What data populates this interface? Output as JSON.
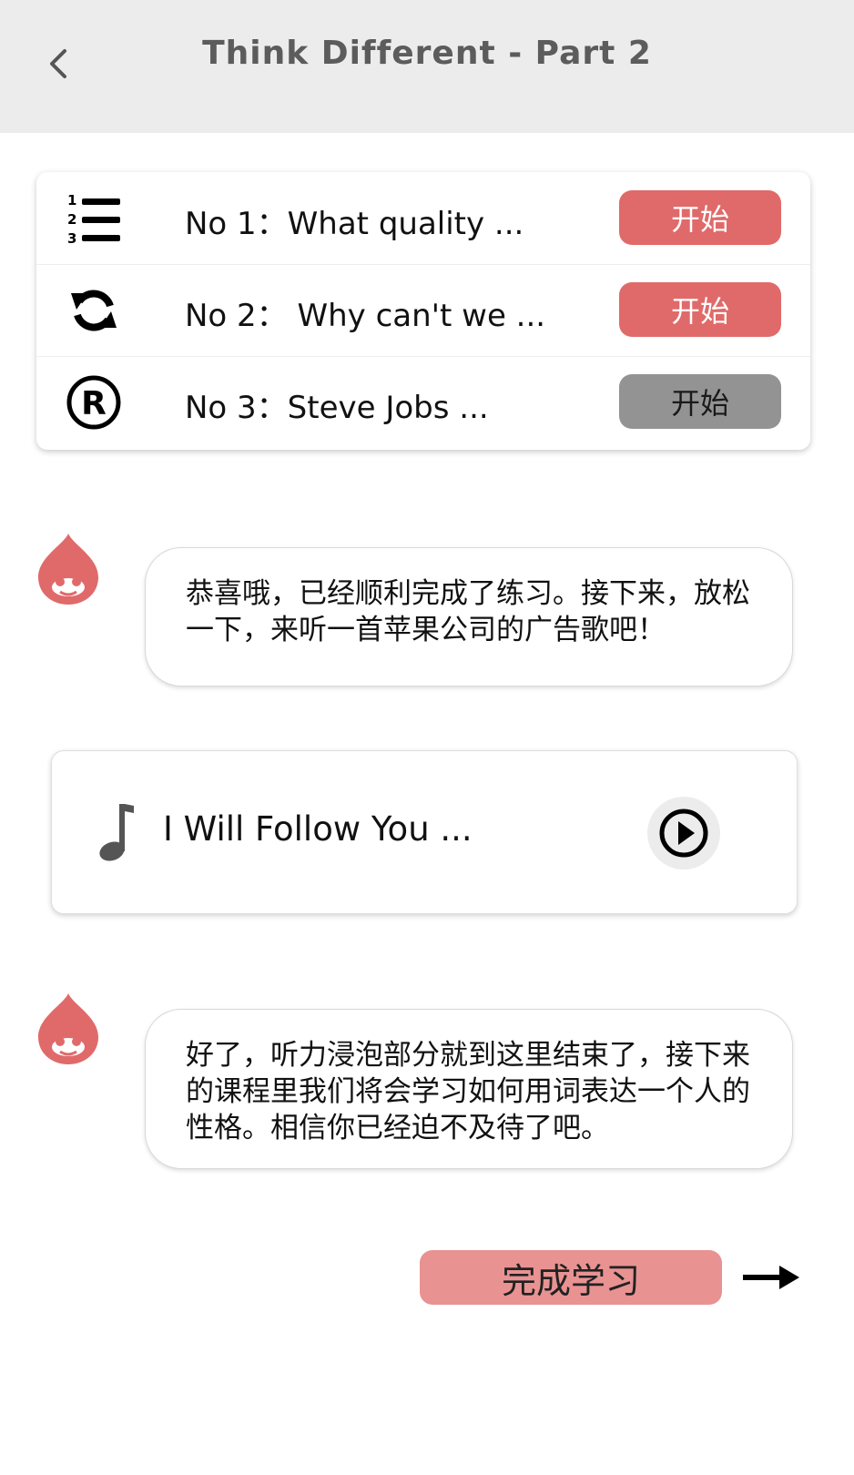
{
  "header": {
    "title": "Think Different - Part 2",
    "back_icon": "chevron-left-icon",
    "background": "#ececec"
  },
  "exercises": [
    {
      "icon": "numbered-list-icon",
      "label": "No 1：What quality ...",
      "button_label": "开始",
      "button_state": "active"
    },
    {
      "icon": "sync-icon",
      "label": "No 2： Why can't we ...",
      "button_label": "开始",
      "button_state": "active"
    },
    {
      "icon": "registered-icon",
      "label": "No 3：Steve Jobs ...",
      "button_label": "开始",
      "button_state": "disabled"
    }
  ],
  "messages": [
    {
      "avatar": "drupal-drop-icon",
      "text": "恭喜哦，已经顺利完成了练习。接下来，放松一下，来听一首苹果公司的广告歌吧！"
    },
    {
      "avatar": "drupal-drop-icon",
      "text": "好了，听力浸泡部分就到这里结束了，接下来的课程里我们将会学习如何用词表达一个人的性格。相信你已经迫不及待了吧。"
    }
  ],
  "music": {
    "icon": "music-note-icon",
    "title": "I Will Follow You ...",
    "play_icon": "play-circle-icon"
  },
  "footer": {
    "complete_label": "完成学习",
    "next_icon": "arrow-right-icon"
  },
  "colors": {
    "accent": "#e06a6a",
    "disabled": "#939393",
    "complete": "#e99292",
    "avatar": "#e06a6a"
  }
}
